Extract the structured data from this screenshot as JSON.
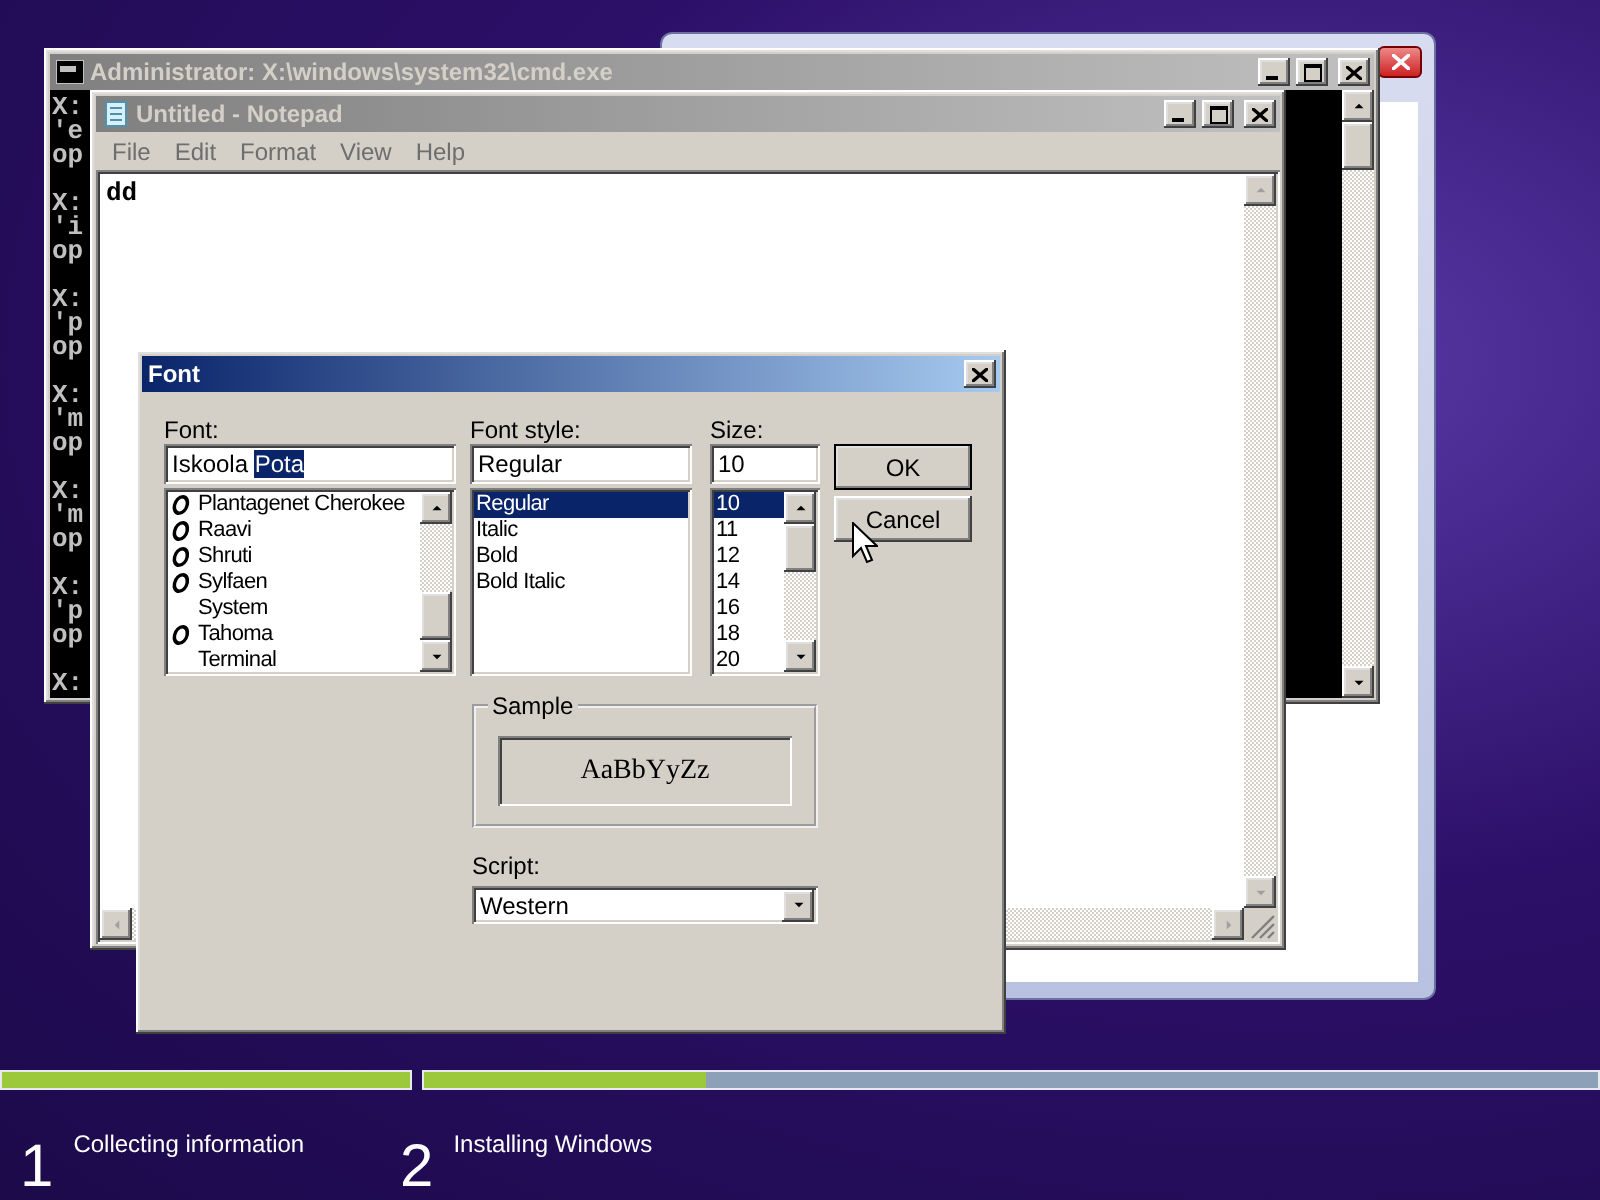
{
  "console_window": {
    "title": "Administrator: X:\\windows\\system32\\cmd.exe",
    "active": false,
    "line_groups": [
      [
        "X:",
        "'e",
        "op"
      ],
      [
        "X:",
        "'i",
        "op"
      ],
      [
        "X:",
        "'p",
        "op"
      ],
      [
        "X:",
        "'m",
        "op"
      ],
      [
        "X:",
        "'m",
        "op"
      ],
      [
        "X:",
        "'p",
        "op"
      ],
      [
        "X:"
      ]
    ]
  },
  "notepad": {
    "title": "Untitled - Notepad",
    "active": false,
    "menu": [
      "File",
      "Edit",
      "Format",
      "View",
      "Help"
    ],
    "text": "dd"
  },
  "font_dialog": {
    "title": "Font",
    "active": true,
    "font": {
      "label": "Font:",
      "value": "Iskoola ",
      "selection": "Pota",
      "items": [
        {
          "name": "Plantagenet Cherokee",
          "kind": "opentype",
          "selected": false
        },
        {
          "name": "Raavi",
          "kind": "opentype",
          "selected": false
        },
        {
          "name": "Shruti",
          "kind": "opentype",
          "selected": false
        },
        {
          "name": "Sylfaen",
          "kind": "opentype",
          "selected": false
        },
        {
          "name": "System",
          "kind": "plain",
          "selected": false
        },
        {
          "name": "Tahoma",
          "kind": "opentype",
          "selected": false
        },
        {
          "name": "Terminal",
          "kind": "plain",
          "selected": false
        }
      ]
    },
    "style": {
      "label": "Font style:",
      "value": "Regular",
      "items": [
        {
          "name": "Regular",
          "selected": true
        },
        {
          "name": "Italic",
          "selected": false
        },
        {
          "name": "Bold",
          "selected": false
        },
        {
          "name": "Bold Italic",
          "selected": false
        }
      ]
    },
    "size": {
      "label": "Size:",
      "value": "10",
      "items": [
        {
          "name": "10",
          "selected": true
        },
        {
          "name": "11",
          "selected": false
        },
        {
          "name": "12",
          "selected": false
        },
        {
          "name": "14",
          "selected": false
        },
        {
          "name": "16",
          "selected": false
        },
        {
          "name": "18",
          "selected": false
        },
        {
          "name": "20",
          "selected": false
        }
      ]
    },
    "buttons": [
      {
        "label": "OK",
        "default": true
      },
      {
        "label": "Cancel",
        "default": false
      }
    ],
    "sample": {
      "label": "Sample",
      "text": "AaBbYyZz"
    },
    "script": {
      "label": "Script:",
      "value": "Western"
    }
  },
  "setup_steps": [
    {
      "number": "1",
      "label": "Collecting information",
      "level": 1
    },
    {
      "number": "2",
      "label": "Installing Windows",
      "level": 0.24
    }
  ]
}
